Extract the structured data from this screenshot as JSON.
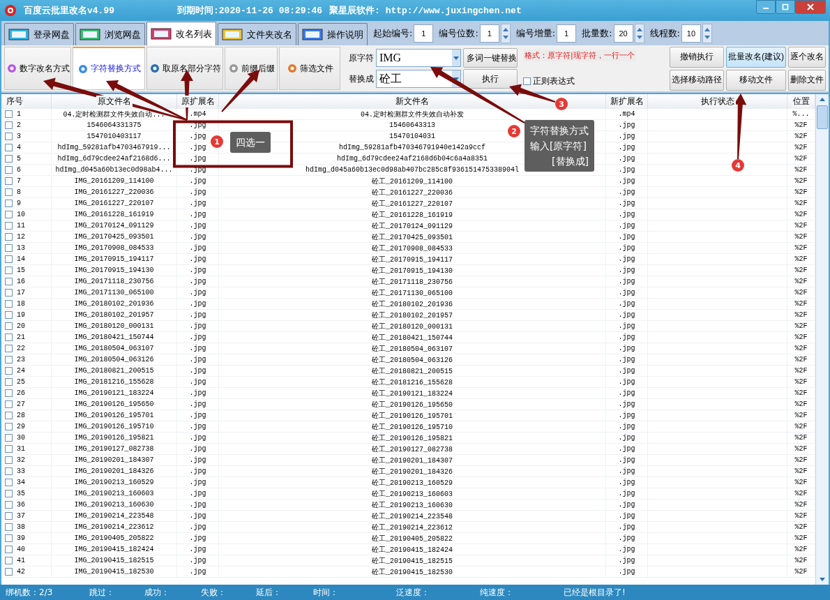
{
  "window": {
    "title": "百度云批里改名v4.99",
    "expiry": "到期时间:2020-11-26 08:29:46",
    "vendor": "聚星辰软件: http://www.juxingchen.net"
  },
  "tabs": [
    {
      "label": "登录网盘",
      "selected": false
    },
    {
      "label": "浏览网盘",
      "selected": false
    },
    {
      "label": "改名列表",
      "selected": true
    },
    {
      "label": "文件夹改名",
      "selected": false
    },
    {
      "label": "操作说明",
      "selected": false
    }
  ],
  "numbering": [
    {
      "label": "起始编号:",
      "value": "1",
      "spinner": false
    },
    {
      "label": "编号位数:",
      "value": "1",
      "spinner": true
    },
    {
      "label": "编号增量:",
      "value": "1",
      "spinner": false
    },
    {
      "label": "批量数:",
      "value": "20",
      "spinner": true
    },
    {
      "label": "线程数:",
      "value": "10",
      "spinner": true
    }
  ],
  "modes": [
    {
      "label": "数字改名方式",
      "selected": false
    },
    {
      "label": "字符替换方式",
      "selected": true
    },
    {
      "label": "取原名部分字符",
      "selected": false
    },
    {
      "label": "前缀后缀",
      "selected": false
    },
    {
      "label": "筛选文件",
      "selected": false
    }
  ],
  "replace": {
    "source_label": "原字符",
    "source_value": "IMG",
    "target_label": "替换成",
    "target_value": "砼工",
    "multi_button": "多词一键替换",
    "run_button": "执行",
    "format_hint": "格式：原字符|现字符，一行一个",
    "regex": {
      "label": "正则表达式",
      "checked": false
    }
  },
  "actions": [
    {
      "label": "撤销执行",
      "selected": false
    },
    {
      "label": "批量改名(建议)",
      "selected": true
    },
    {
      "label": "逐个改名",
      "selected": false
    },
    {
      "label": "选择移动路径",
      "selected": false
    },
    {
      "label": "移动文件",
      "selected": false
    },
    {
      "label": "删除文件",
      "selected": false
    }
  ],
  "table": {
    "columns": [
      "序号",
      "原文件名",
      "原扩展名",
      "新文件名",
      "新扩展名",
      "执行状态",
      "位置"
    ],
    "rows": [
      {
        "index": "1",
        "checked": false,
        "name": "04.定时检测群文件失效自动...",
        "ext": ".mp4",
        "new_name": "04.定时检测群文件失效自动补发",
        "new_ext": ".mp4",
        "position": "%..."
      },
      {
        "index": "2",
        "checked": false,
        "name": "1546064331375",
        "ext": ".jpg",
        "new_name": "15460643313",
        "new_ext": ".jpg",
        "position": "%2F"
      },
      {
        "index": "3",
        "checked": false,
        "name": "1547010403117",
        "ext": ".jpg",
        "new_name": "15470104031",
        "new_ext": ".jpg",
        "position": "%2F"
      },
      {
        "index": "4",
        "checked": false,
        "name": "hdImg_59281afb4703467919...",
        "ext": ".jpg",
        "new_name": "hdImg_59281afb470346791940e142a9ccf",
        "new_ext": ".jpg",
        "position": "%2F"
      },
      {
        "index": "5",
        "checked": false,
        "name": "hdImg_6d79cdee24af2168d6...",
        "ext": ".jpg",
        "new_name": "hdImg_6d79cdee24af2168d6b04c6a4a8351",
        "new_ext": ".jpg",
        "position": "%2F"
      },
      {
        "index": "6",
        "checked": false,
        "name": "hdImg_d045a60b13ec0d98ab4...",
        "ext": ".jpg",
        "new_name": "hdImg_d045a60b13ec0d98ab407bc285c8f936151475338904l",
        "new_ext": ".jpg",
        "position": "%2F"
      },
      {
        "index": "7",
        "checked": false,
        "name": "IMG_20161209_114100",
        "ext": ".jpg",
        "new_name": "砼工_20161209_114100",
        "new_ext": ".jpg",
        "position": "%2F"
      },
      {
        "index": "8",
        "checked": false,
        "name": "IMG_20161227_220036",
        "ext": ".jpg",
        "new_name": "砼工_20161227_220036",
        "new_ext": ".jpg",
        "position": "%2F"
      },
      {
        "index": "9",
        "checked": false,
        "name": "IMG_20161227_220107",
        "ext": ".jpg",
        "new_name": "砼工_20161227_220107",
        "new_ext": ".jpg",
        "position": "%2F"
      },
      {
        "index": "10",
        "checked": false,
        "name": "IMG_20161228_161919",
        "ext": ".jpg",
        "new_name": "砼工_20161228_161919",
        "new_ext": ".jpg",
        "position": "%2F"
      },
      {
        "index": "11",
        "checked": false,
        "name": "IMG_20170124_091129",
        "ext": ".jpg",
        "new_name": "砼工_20170124_091129",
        "new_ext": ".jpg",
        "position": "%2F"
      },
      {
        "index": "12",
        "checked": false,
        "name": "IMG_20170425_093501",
        "ext": ".jpg",
        "new_name": "砼工_20170425_093501",
        "new_ext": ".jpg",
        "position": "%2F"
      },
      {
        "index": "13",
        "checked": false,
        "name": "IMG_20170908_084533",
        "ext": ".jpg",
        "new_name": "砼工_20170908_084533",
        "new_ext": ".jpg",
        "position": "%2F"
      },
      {
        "index": "14",
        "checked": false,
        "name": "IMG_20170915_194117",
        "ext": ".jpg",
        "new_name": "砼工_20170915_194117",
        "new_ext": ".jpg",
        "position": "%2F"
      },
      {
        "index": "15",
        "checked": false,
        "name": "IMG_20170915_194130",
        "ext": ".jpg",
        "new_name": "砼工_20170915_194130",
        "new_ext": ".jpg",
        "position": "%2F"
      },
      {
        "index": "16",
        "checked": false,
        "name": "IMG_20171118_230756",
        "ext": ".jpg",
        "new_name": "砼工_20171118_230756",
        "new_ext": ".jpg",
        "position": "%2F"
      },
      {
        "index": "17",
        "checked": false,
        "name": "IMG_20171130_065100",
        "ext": ".jpg",
        "new_name": "砼工_20171130_065100",
        "new_ext": ".jpg",
        "position": "%2F"
      },
      {
        "index": "18",
        "checked": false,
        "name": "IMG_20180102_201936",
        "ext": ".jpg",
        "new_name": "砼工_20180102_201936",
        "new_ext": ".jpg",
        "position": "%2F"
      },
      {
        "index": "19",
        "checked": false,
        "name": "IMG_20180102_201957",
        "ext": ".jpg",
        "new_name": "砼工_20180102_201957",
        "new_ext": ".jpg",
        "position": "%2F"
      },
      {
        "index": "20",
        "checked": false,
        "name": "IMG_20180120_000131",
        "ext": ".jpg",
        "new_name": "砼工_20180120_000131",
        "new_ext": ".jpg",
        "position": "%2F"
      },
      {
        "index": "21",
        "checked": false,
        "name": "IMG_20180421_150744",
        "ext": ".jpg",
        "new_name": "砼工_20180421_150744",
        "new_ext": ".jpg",
        "position": "%2F"
      },
      {
        "index": "22",
        "checked": false,
        "name": "IMG_20180504_063107",
        "ext": ".jpg",
        "new_name": "砼工_20180504_063107",
        "new_ext": ".jpg",
        "position": "%2F"
      },
      {
        "index": "23",
        "checked": false,
        "name": "IMG_20180504_063126",
        "ext": ".jpg",
        "new_name": "砼工_20180504_063126",
        "new_ext": ".jpg",
        "position": "%2F"
      },
      {
        "index": "24",
        "checked": false,
        "name": "IMG_20180821_200515",
        "ext": ".jpg",
        "new_name": "砼工_20180821_200515",
        "new_ext": ".jpg",
        "position": "%2F"
      },
      {
        "index": "25",
        "checked": false,
        "name": "IMG_20181216_155628",
        "ext": ".jpg",
        "new_name": "砼工_20181216_155628",
        "new_ext": ".jpg",
        "position": "%2F"
      },
      {
        "index": "26",
        "checked": false,
        "name": "IMG_20190121_183224",
        "ext": ".jpg",
        "new_name": "砼工_20190121_183224",
        "new_ext": ".jpg",
        "position": "%2F"
      },
      {
        "index": "27",
        "checked": false,
        "name": "IMG_20190126_195650",
        "ext": ".jpg",
        "new_name": "砼工_20190126_195650",
        "new_ext": ".jpg",
        "position": "%2F"
      },
      {
        "index": "28",
        "checked": false,
        "name": "IMG_20190126_195701",
        "ext": ".jpg",
        "new_name": "砼工_20190126_195701",
        "new_ext": ".jpg",
        "position": "%2F"
      },
      {
        "index": "29",
        "checked": false,
        "name": "IMG_20190126_195710",
        "ext": ".jpg",
        "new_name": "砼工_20190126_195710",
        "new_ext": ".jpg",
        "position": "%2F"
      },
      {
        "index": "30",
        "checked": false,
        "name": "IMG_20190126_195821",
        "ext": ".jpg",
        "new_name": "砼工_20190126_195821",
        "new_ext": ".jpg",
        "position": "%2F"
      },
      {
        "index": "31",
        "checked": false,
        "name": "IMG_20190127_082738",
        "ext": ".jpg",
        "new_name": "砼工_20190127_082738",
        "new_ext": ".jpg",
        "position": "%2F"
      },
      {
        "index": "32",
        "checked": false,
        "name": "IMG_20190201_184307",
        "ext": ".jpg",
        "new_name": "砼工_20190201_184307",
        "new_ext": ".jpg",
        "position": "%2F"
      },
      {
        "index": "33",
        "checked": false,
        "name": "IMG_20190201_184326",
        "ext": ".jpg",
        "new_name": "砼工_20190201_184326",
        "new_ext": ".jpg",
        "position": "%2F"
      },
      {
        "index": "34",
        "checked": false,
        "name": "IMG_20190213_160529",
        "ext": ".jpg",
        "new_name": "砼工_20190213_160529",
        "new_ext": ".jpg",
        "position": "%2F"
      },
      {
        "index": "35",
        "checked": false,
        "name": "IMG_20190213_160603",
        "ext": ".jpg",
        "new_name": "砼工_20190213_160603",
        "new_ext": ".jpg",
        "position": "%2F"
      },
      {
        "index": "36",
        "checked": false,
        "name": "IMG_20190213_160630",
        "ext": ".jpg",
        "new_name": "砼工_20190213_160630",
        "new_ext": ".jpg",
        "position": "%2F"
      },
      {
        "index": "37",
        "checked": false,
        "name": "IMG_20190214_223548",
        "ext": ".jpg",
        "new_name": "砼工_20190214_223548",
        "new_ext": ".jpg",
        "position": "%2F"
      },
      {
        "index": "38",
        "checked": false,
        "name": "IMG_20190214_223612",
        "ext": ".jpg",
        "new_name": "砼工_20190214_223612",
        "new_ext": ".jpg",
        "position": "%2F"
      },
      {
        "index": "39",
        "checked": false,
        "name": "IMG_20190405_205822",
        "ext": ".jpg",
        "new_name": "砼工_20190405_205822",
        "new_ext": ".jpg",
        "position": "%2F"
      },
      {
        "index": "40",
        "checked": false,
        "name": "IMG_20190415_182424",
        "ext": ".jpg",
        "new_name": "砼工_20190415_182424",
        "new_ext": ".jpg",
        "position": "%2F"
      },
      {
        "index": "41",
        "checked": false,
        "name": "IMG_20190415_182515",
        "ext": ".jpg",
        "new_name": "砼工_20190415_182515",
        "new_ext": ".jpg",
        "position": "%2F"
      },
      {
        "index": "42",
        "checked": false,
        "name": "IMG_20190415_182530",
        "ext": ".jpg",
        "new_name": "砼工_20190415_182530",
        "new_ext": ".jpg",
        "position": "%2F"
      }
    ]
  },
  "status_bar": [
    "绑机数：2/3",
    "跳过：",
    "成功：",
    "失败：",
    "延后：",
    "时间：",
    "泛速度：",
    "纯速度：",
    "已经是根目录了!"
  ],
  "annotations": [
    {
      "marker": "1",
      "tooltip": [
        "四选一"
      ]
    },
    {
      "marker": "2",
      "tooltip": [
        "字符替换方式",
        "输入[原字符]",
        "[替换成]"
      ]
    },
    {
      "marker": "3"
    },
    {
      "marker": "4"
    }
  ]
}
